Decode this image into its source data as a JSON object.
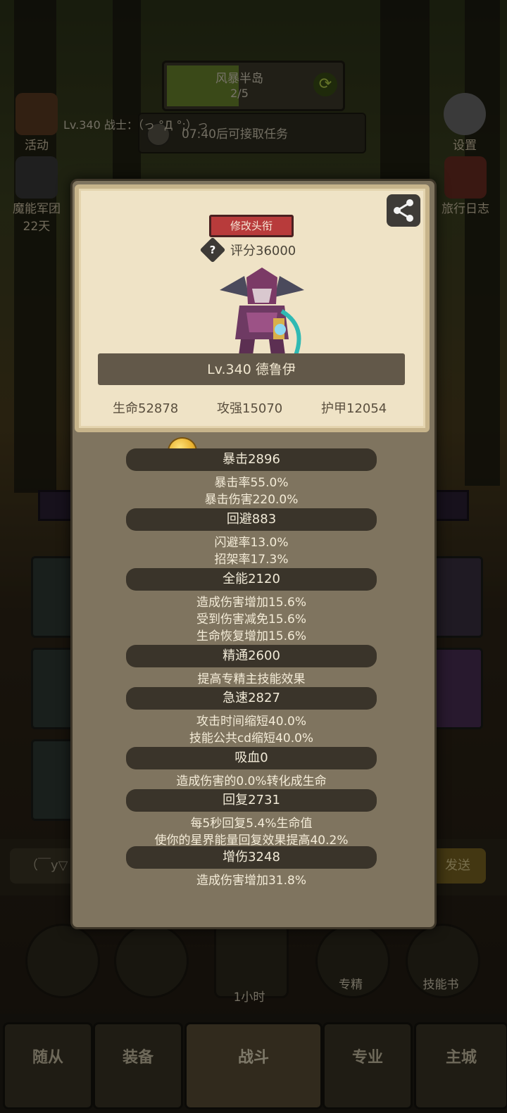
{
  "hud": {
    "zone_name": "风暴半岛",
    "zone_progress": "2/5",
    "quest_timer": "07:40后可接取任务",
    "player_line": "Lv.340 战士：（っ °Д °;）っ",
    "left_icons": [
      {
        "label": "活动",
        "icon": "scroll-icon"
      },
      {
        "label": "魔能军团",
        "sub": "22天",
        "icon": "demon-icon"
      }
    ],
    "right_icons": [
      {
        "label": "设置",
        "icon": "gear-icon"
      },
      {
        "label": "旅行日志",
        "icon": "book-icon"
      }
    ]
  },
  "chat": {
    "input_text": "（￣y▽",
    "send_label": "发送"
  },
  "round_buttons": [
    {
      "label": "",
      "icon": "potion-icon"
    },
    {
      "label": "",
      "icon": "stone-icon"
    },
    {
      "label": "1小时",
      "icon": "chest-icon"
    },
    {
      "label": "专精",
      "icon": "spec-icon"
    },
    {
      "label": "技能书",
      "icon": "skillbook-icon"
    }
  ],
  "nav": {
    "tabs": [
      "随从",
      "装备",
      "战斗",
      "专业",
      "主城"
    ],
    "active": "战斗"
  },
  "profile": {
    "change_title_label": "修改头衔",
    "score": "评分36000",
    "name": "Lv.340 德鲁伊",
    "hp": "生命52878",
    "attack": "攻强15070",
    "armor": "护甲12054"
  },
  "stats": [
    {
      "title": "暴击2896",
      "lines": [
        "暴击率55.0%",
        "暴击伤害220.0%"
      ]
    },
    {
      "title": "回避883",
      "lines": [
        "闪避率13.0%",
        "招架率17.3%"
      ]
    },
    {
      "title": "全能2120",
      "lines": [
        "造成伤害增加15.6%",
        "受到伤害减免15.6%",
        "生命恢复增加15.6%"
      ]
    },
    {
      "title": "精通2600",
      "lines": [
        "提高专精主技能效果"
      ]
    },
    {
      "title": "急速2827",
      "lines": [
        "攻击时间缩短40.0%",
        "技能公共cd缩短40.0%"
      ]
    },
    {
      "title": "吸血0",
      "lines": [
        "造成伤害的0.0%转化成生命"
      ]
    },
    {
      "title": "回复2731",
      "lines": [
        "每5秒回复5.4%生命值",
        "使你的星界能量回复效果提高40.2%"
      ]
    },
    {
      "title": "增伤3248",
      "lines": [
        "造成伤害增加31.8%"
      ]
    }
  ]
}
